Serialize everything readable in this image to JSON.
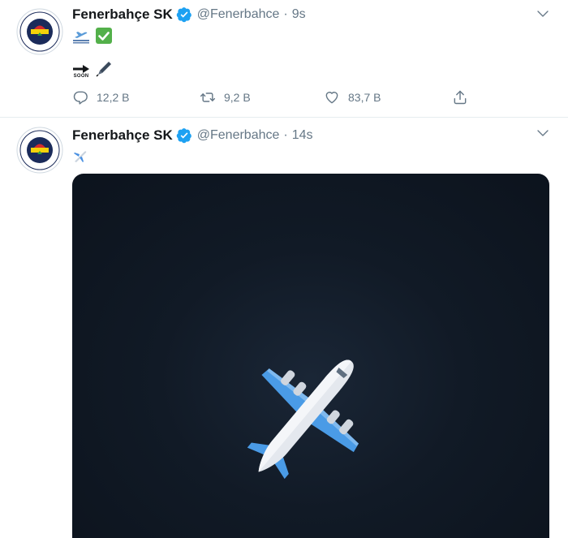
{
  "tweets": [
    {
      "name": "Fenerbahçe SK",
      "handle": "@Fenerbahce",
      "separator": "·",
      "time": "9s",
      "text_emojis": [
        "🛫",
        "✅"
      ],
      "second_line": [
        "➡",
        "SOON",
        "🖋"
      ],
      "actions": {
        "reply_count": "12,2 B",
        "retweet_count": "9,2 B",
        "like_count": "83,7 B"
      }
    },
    {
      "name": "Fenerbahçe SK",
      "handle": "@Fenerbahce",
      "separator": "·",
      "time": "14s",
      "text_emojis": [
        "✈️"
      ],
      "media": {
        "icon": "airplane-icon"
      }
    }
  ],
  "colors": {
    "verified": "#1da1f2",
    "secondary_text": "#657786",
    "media_background": "#0f1722"
  }
}
